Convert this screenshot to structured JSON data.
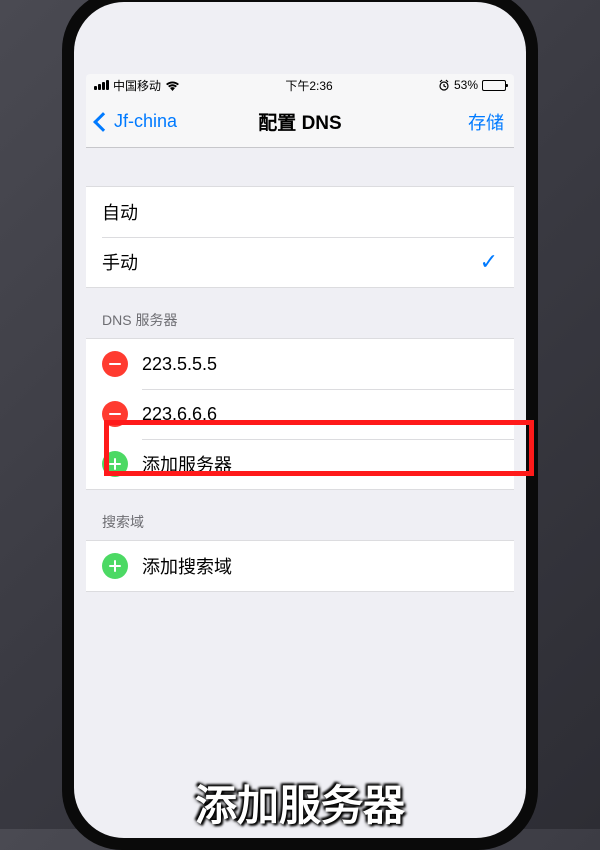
{
  "status": {
    "carrier": "中国移动",
    "time": "下午2:36",
    "battery_pct": "53%"
  },
  "nav": {
    "back_label": "Jf-china",
    "title": "配置 DNS",
    "save_label": "存储"
  },
  "mode": {
    "auto_label": "自动",
    "manual_label": "手动"
  },
  "dns": {
    "header": "DNS 服务器",
    "servers": [
      "223.5.5.5",
      "223.6.6.6"
    ],
    "add_label": "添加服务器"
  },
  "search_domains": {
    "header": "搜索域",
    "add_label": "添加搜索域"
  },
  "caption": "添加服务器"
}
